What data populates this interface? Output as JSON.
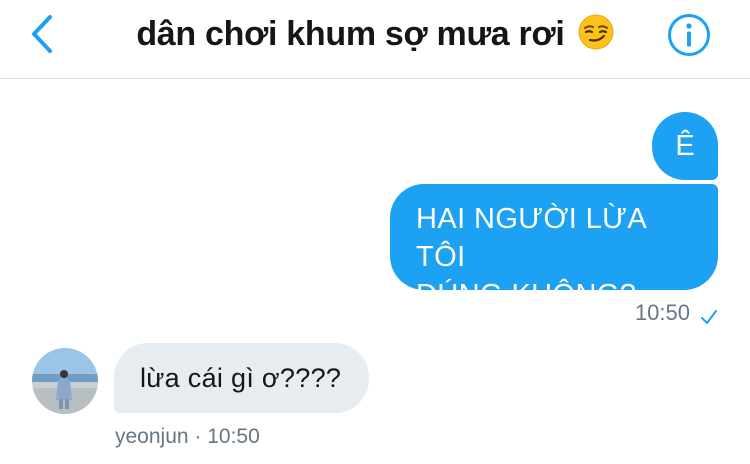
{
  "header": {
    "title": "dân chơi khum sợ mưa rơi",
    "title_emoji": "smirking-face",
    "back_icon": "chevron-left-icon",
    "info_icon": "info-circle-icon"
  },
  "colors": {
    "accent": "#1da1f2",
    "incoming_bubble": "#e6ecf0",
    "meta_text": "#657786"
  },
  "messages": {
    "outgoing_1": "Ê",
    "outgoing_2_line1": "HAI NGƯỜI LỪA TÔI",
    "outgoing_2_line2": "ĐÚNG KHÔNG?",
    "outgoing_time": "10:50",
    "outgoing_status_icon": "checkmark-icon",
    "incoming_1": "lừa cái gì ơ????",
    "incoming_meta": "yeonjun · 10:50"
  }
}
